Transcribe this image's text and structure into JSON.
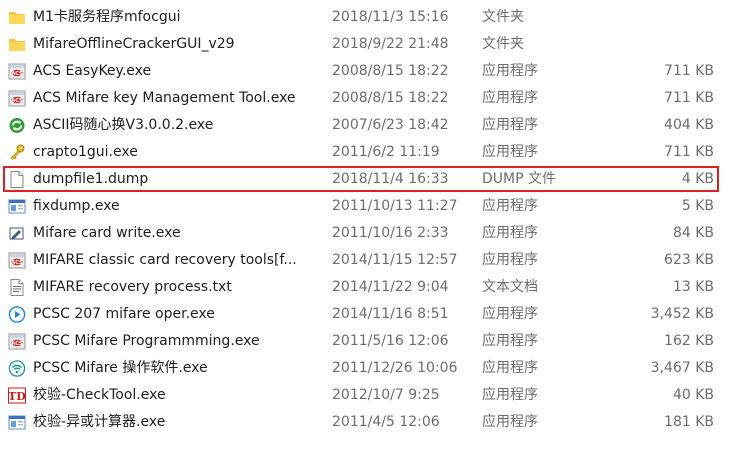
{
  "highlight_color": "#e02020",
  "rows": [
    {
      "name": "M1卡服务程序mfocgui",
      "date": "2018/11/3 15:16",
      "type": "文件夹",
      "size": "",
      "icon": "folder-icon",
      "highlighted": false
    },
    {
      "name": "MifareOfflineCrackerGUI_v29",
      "date": "2018/9/22 21:48",
      "type": "文件夹",
      "size": "",
      "icon": "folder-icon",
      "highlighted": false
    },
    {
      "name": "ACS EasyKey.exe",
      "date": "2008/8/15 18:22",
      "type": "应用程序",
      "size": "711 KB",
      "icon": "acs-app-icon",
      "highlighted": false
    },
    {
      "name": "ACS Mifare key Management Tool.exe",
      "date": "2008/8/15 18:22",
      "type": "应用程序",
      "size": "711 KB",
      "icon": "acs-app-icon",
      "highlighted": false
    },
    {
      "name": "ASCII码随心换V3.0.0.2.exe",
      "date": "2007/6/23 18:42",
      "type": "应用程序",
      "size": "404 KB",
      "icon": "green-refresh-icon",
      "highlighted": false
    },
    {
      "name": "crapto1gui.exe",
      "date": "2011/6/2 11:19",
      "type": "应用程序",
      "size": "711 KB",
      "icon": "key-icon",
      "highlighted": false
    },
    {
      "name": "dumpfile1.dump",
      "date": "2018/11/4 16:33",
      "type": "DUMP 文件",
      "size": "4 KB",
      "icon": "blank-file-icon",
      "highlighted": true
    },
    {
      "name": "fixdump.exe",
      "date": "2011/10/13 11:27",
      "type": "应用程序",
      "size": "5 KB",
      "icon": "app-window-icon",
      "highlighted": false
    },
    {
      "name": "Mifare card write.exe",
      "date": "2011/10/16 2:33",
      "type": "应用程序",
      "size": "84 KB",
      "icon": "card-write-icon",
      "highlighted": false
    },
    {
      "name": "MIFARE classic card recovery tools[f...",
      "date": "2014/11/15 12:57",
      "type": "应用程序",
      "size": "623 KB",
      "icon": "acs-app-icon",
      "highlighted": false
    },
    {
      "name": "MIFARE recovery process.txt",
      "date": "2014/11/22 9:04",
      "type": "文本文档",
      "size": "13 KB",
      "icon": "text-file-icon",
      "highlighted": false
    },
    {
      "name": "PCSC 207 mifare oper.exe",
      "date": "2014/11/16 8:51",
      "type": "应用程序",
      "size": "3,452 KB",
      "icon": "play-icon",
      "highlighted": false
    },
    {
      "name": "PCSC Mifare Programmming.exe",
      "date": "2011/5/16 12:06",
      "type": "应用程序",
      "size": "162 KB",
      "icon": "acs-app-icon",
      "highlighted": false
    },
    {
      "name": "PCSC Mifare 操作软件.exe",
      "date": "2011/12/26 10:06",
      "type": "应用程序",
      "size": "3,467 KB",
      "icon": "wireless-icon",
      "highlighted": false
    },
    {
      "name": "校验-CheckTool.exe",
      "date": "2012/10/7 9:25",
      "type": "应用程序",
      "size": "40 KB",
      "icon": "td-icon",
      "highlighted": false
    },
    {
      "name": "校验-异或计算器.exe",
      "date": "2011/4/5 12:06",
      "type": "应用程序",
      "size": "181 KB",
      "icon": "app-window-icon",
      "highlighted": false
    }
  ]
}
